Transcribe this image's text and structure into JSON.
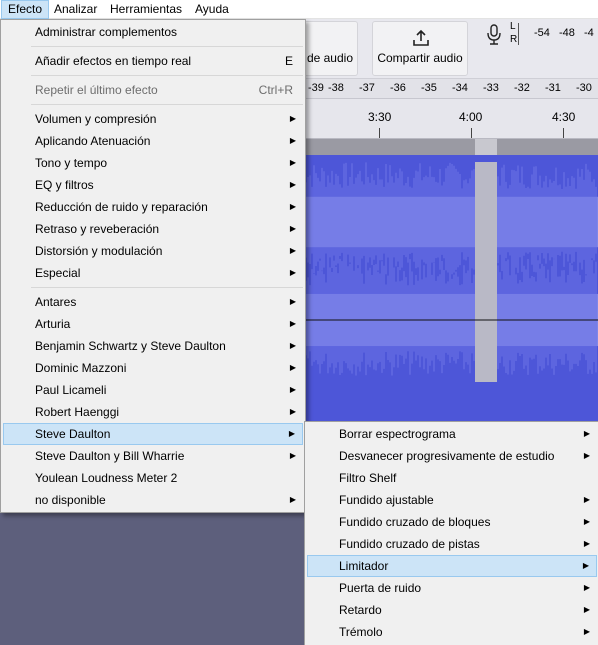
{
  "menubar": {
    "items": [
      {
        "label": "Efecto"
      },
      {
        "label": "Analizar"
      },
      {
        "label": "Herramientas"
      },
      {
        "label": "Ayuda"
      }
    ]
  },
  "toolbar": {
    "share_audio_partial_label": "de audio",
    "share_audio_label": "Compartir audio",
    "meter_lr": {
      "l": "L",
      "r": "R"
    },
    "meter_scale_top": [
      "-54",
      "-48",
      "-4"
    ],
    "meter_scale_bottom": [
      "-39",
      "-38",
      "-37",
      "-36",
      "-35",
      "-34",
      "-33",
      "-32",
      "-31",
      "-30"
    ]
  },
  "timeline": {
    "labels": [
      "3:30",
      "4:00",
      "4:30"
    ]
  },
  "effect_menu": {
    "items": [
      {
        "label": "Administrar complementos"
      },
      {
        "label": "Añadir efectos en tiempo real",
        "shortcut": "E"
      },
      {
        "label": "Repetir el último efecto",
        "shortcut": "Ctrl+R"
      },
      {
        "label": "Volumen y compresión"
      },
      {
        "label": "Aplicando Atenuación"
      },
      {
        "label": "Tono y tempo"
      },
      {
        "label": "EQ y filtros"
      },
      {
        "label": "Reducción de ruido y reparación"
      },
      {
        "label": "Retraso y reveberación"
      },
      {
        "label": "Distorsión y modulación"
      },
      {
        "label": "Especial"
      },
      {
        "label": "Antares"
      },
      {
        "label": "Arturia"
      },
      {
        "label": "Benjamin Schwartz y Steve Daulton"
      },
      {
        "label": "Dominic Mazzoni"
      },
      {
        "label": "Paul Licameli"
      },
      {
        "label": "Robert Haenggi"
      },
      {
        "label": "Steve Daulton"
      },
      {
        "label": "Steve Daulton y Bill Wharrie"
      },
      {
        "label": "Youlean Loudness Meter 2"
      },
      {
        "label": "no disponible"
      }
    ]
  },
  "steve_daulton_submenu": {
    "items": [
      {
        "label": "Borrar espectrograma"
      },
      {
        "label": "Desvanecer progresivamente de estudio"
      },
      {
        "label": "Filtro Shelf"
      },
      {
        "label": "Fundido ajustable"
      },
      {
        "label": "Fundido cruzado de bloques"
      },
      {
        "label": "Fundido cruzado de pistas"
      },
      {
        "label": "Limitador"
      },
      {
        "label": "Puerta de ruido"
      },
      {
        "label": "Retardo"
      },
      {
        "label": "Trémolo"
      }
    ]
  },
  "colors": {
    "highlight": "#cce4f7",
    "highlight_border": "#99c9ef",
    "waveform": "#4d56d8",
    "waveform_light": "#7f86e8",
    "background": "#5d5f7c"
  }
}
